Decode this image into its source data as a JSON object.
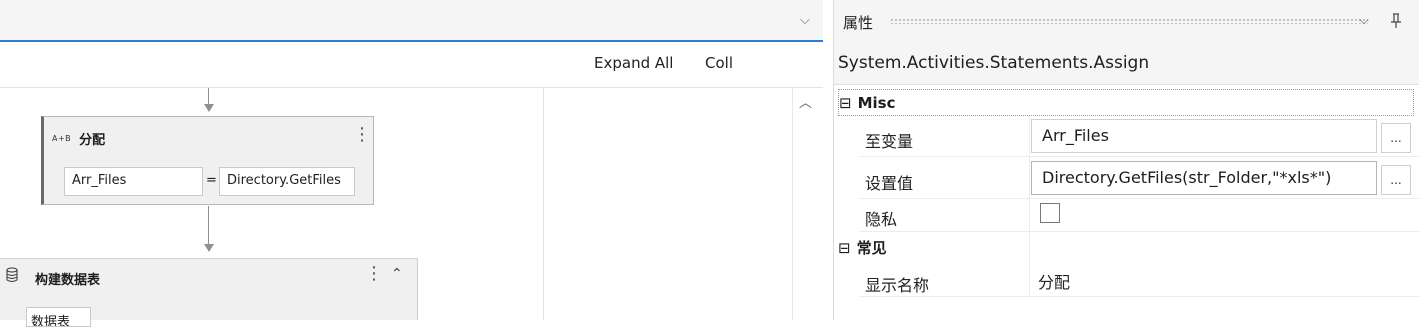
{
  "designer": {
    "expand_all": "Expand All",
    "collapse_all": "Coll",
    "assign_activity": {
      "icon_text": "A+B",
      "title": "分配",
      "to": "Arr_Files",
      "equals": "=",
      "value": "Directory.GetFiles"
    },
    "build_table": {
      "title": "构建数据表",
      "button": "数据表"
    }
  },
  "properties": {
    "title": "属性",
    "type_name": "System.Activities.Statements.Assign",
    "sections": [
      {
        "toggle": "⊟",
        "name": "Misc",
        "rows": [
          {
            "name": "至变量",
            "value": "Arr_Files",
            "button": "..."
          },
          {
            "name": "设置值",
            "value": "Directory.GetFiles(str_Folder,\"*xls*\")",
            "button": "..."
          },
          {
            "name": "隐私",
            "checked": false
          }
        ]
      },
      {
        "toggle": "⊟",
        "name": "常见",
        "rows": [
          {
            "name": "显示名称",
            "value": "分配"
          }
        ]
      }
    ]
  },
  "icons": {
    "dropdown": "chevron-down-icon",
    "pin": "pin-icon",
    "scroll_up": "scroll-up-icon",
    "kebab": "kebab-menu-icon",
    "collapse": "collapse-up-icon",
    "table": "table-icon",
    "accent": "#2b7cd3"
  }
}
